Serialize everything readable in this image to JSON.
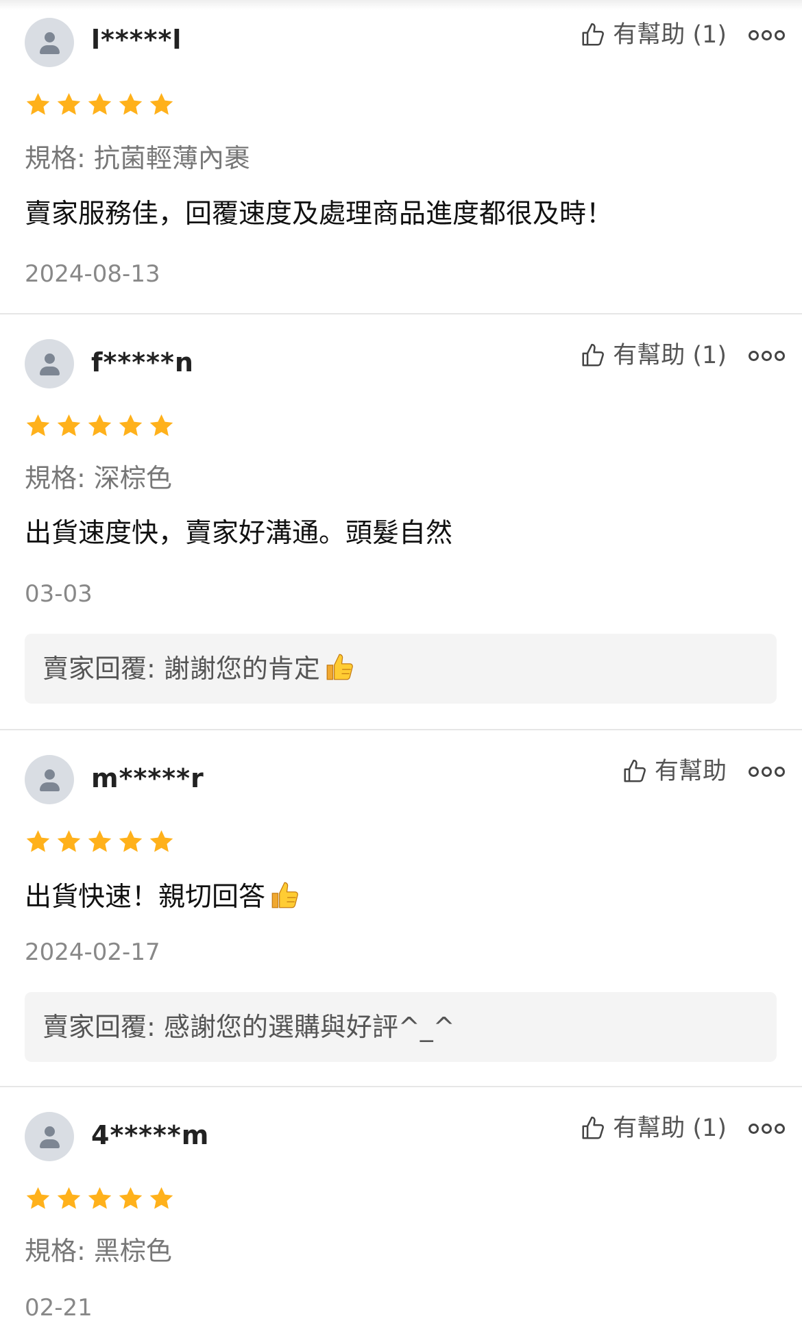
{
  "reviews": [
    {
      "username": "l*****l",
      "helpful_label": "有幫助 (1)",
      "rating": 5,
      "spec": "規格: 抗菌輕薄內裹",
      "text": "賣家服務佳，回覆速度及處理商品進度都很及時！",
      "date": "2024-08-13"
    },
    {
      "username": "f*****n",
      "helpful_label": "有幫助 (1)",
      "rating": 5,
      "spec": "規格: 深棕色",
      "text": "出貨速度快，賣家好溝通。頭髮自然",
      "date": "03-03",
      "reply": "賣家回覆: 謝謝您的肯定"
    },
    {
      "username": "m*****r",
      "helpful_label": "有幫助",
      "rating": 5,
      "text": "出貨快速！親切回答",
      "date": "2024-02-17",
      "reply": "賣家回覆: 感謝您的選購與好評^_^"
    },
    {
      "username": "4*****m",
      "helpful_label": "有幫助 (1)",
      "rating": 5,
      "spec": "規格: 黑棕色",
      "date": "02-21"
    }
  ],
  "colors": {
    "star": "#ffb11b",
    "avatar_bg": "#d9dde3",
    "avatar_fg": "#7d8693",
    "reply_bg": "#f4f4f4",
    "divider": "#e6e6e6"
  },
  "icons": {
    "helpful": "thumbs-up-outline-icon",
    "more": "more-options-icon",
    "emoji": "thumbs-up-emoji"
  }
}
